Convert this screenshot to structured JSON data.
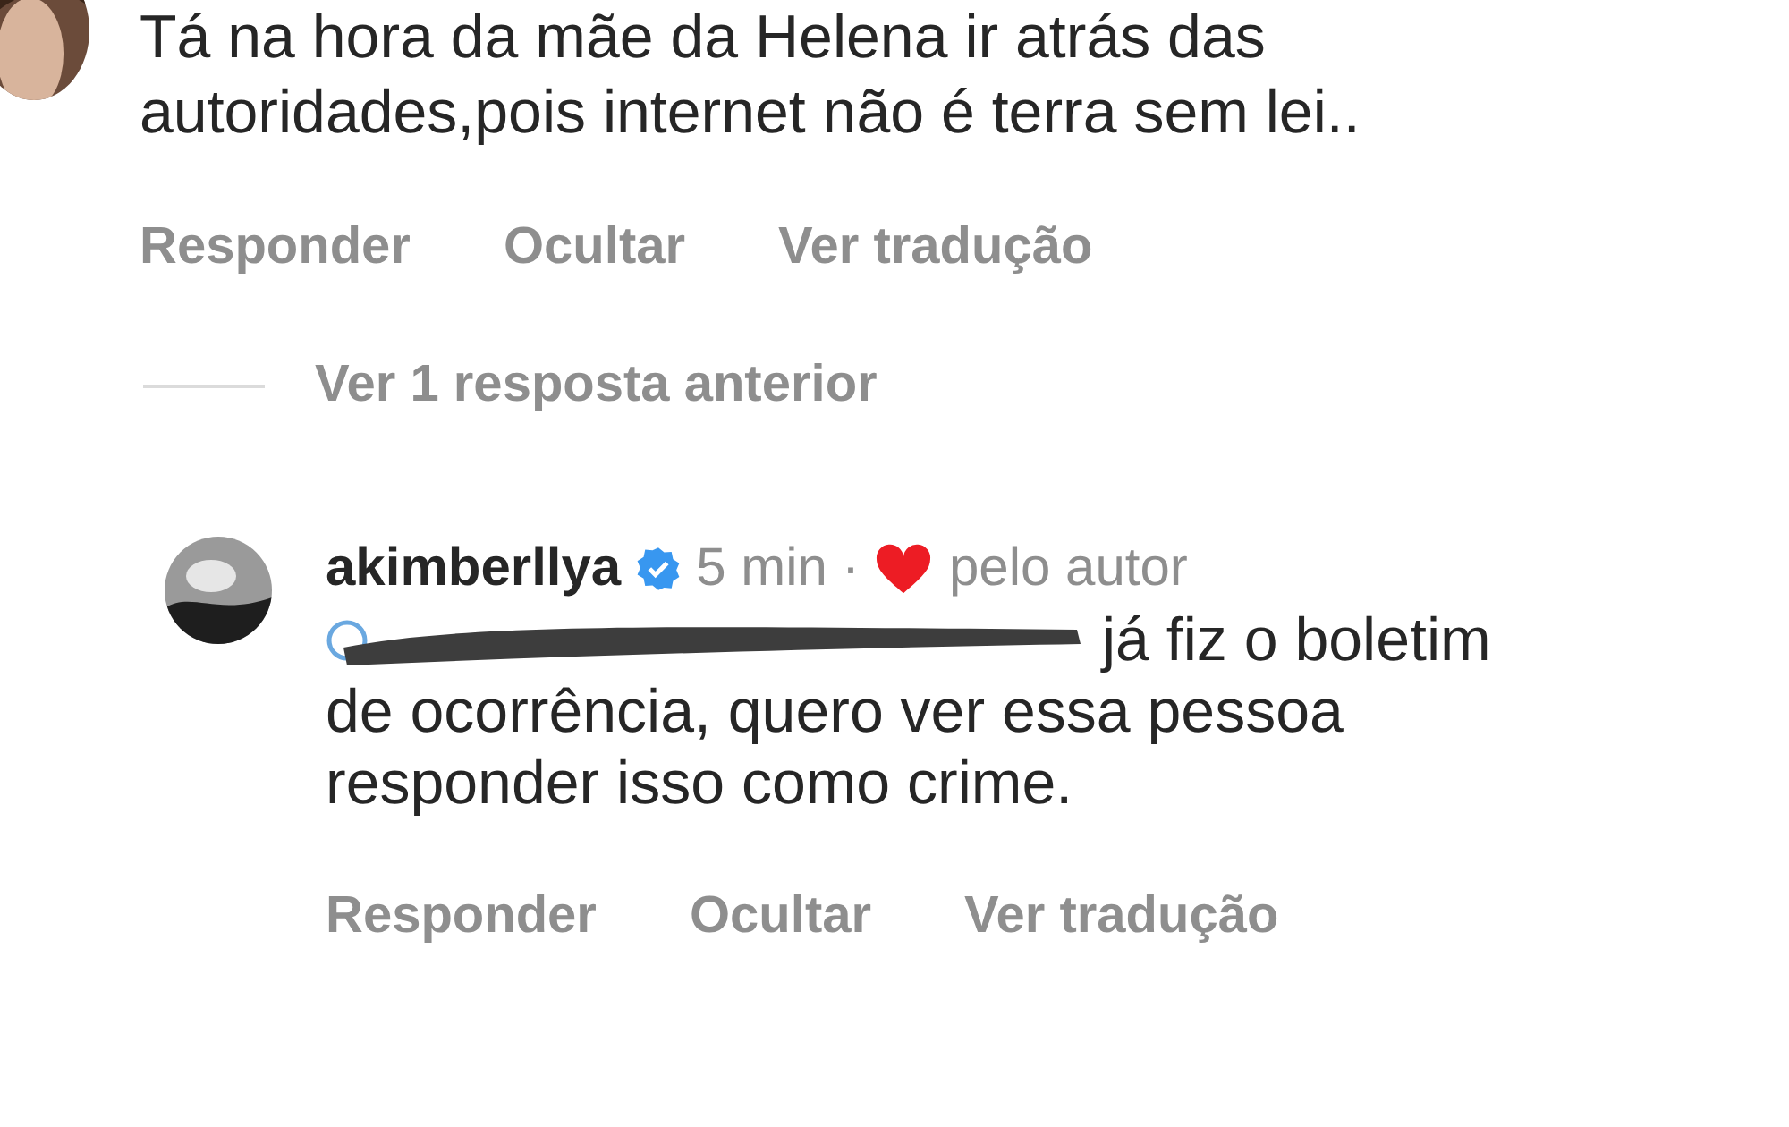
{
  "comments": [
    {
      "kind": "parent",
      "text_lines": [
        "Tá na hora da mãe da Helena ir atrás das",
        "autoridades,pois internet não é terra sem lei.."
      ],
      "actions": [
        "Responder",
        "Ocultar",
        "Ver tradução"
      ]
    },
    {
      "kind": "reply",
      "username": "akimberllya",
      "verified": true,
      "time": "5 min",
      "separator": "·",
      "liked_by_author": true,
      "liked_label": "pelo autor",
      "text_lines": [
        "já fiz o boletim",
        "de ocorrência, quero ver essa pessoa",
        "responder isso como crime."
      ],
      "mention_redacted": true,
      "actions": [
        "Responder",
        "Ocultar",
        "Ver tradução"
      ]
    }
  ],
  "view_replies": "Ver 1 resposta anterior"
}
